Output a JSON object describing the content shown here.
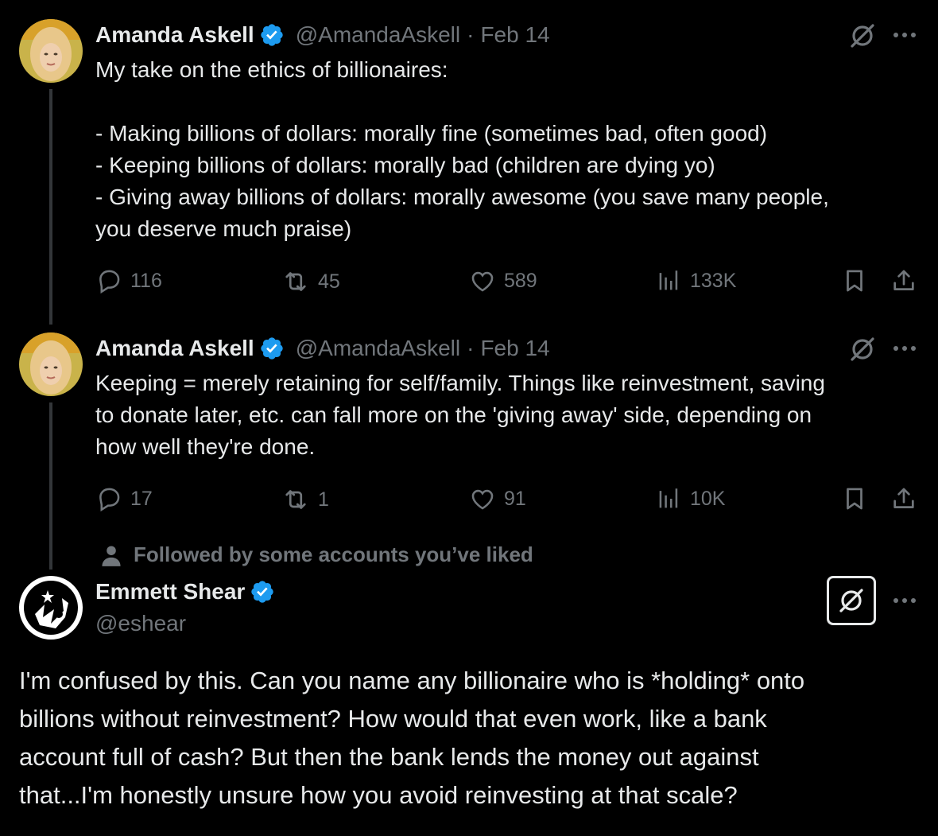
{
  "tweets": [
    {
      "name": "Amanda Askell",
      "handle": "@AmandaAskell",
      "separator": "·",
      "date": "Feb 14",
      "text": "My take on the ethics of billionaires:\n\n- Making billions of dollars: morally fine (sometimes bad, often good)\n- Keeping billions of dollars: morally bad (children are dying yo)\n- Giving away billions of dollars: morally awesome (you save many people,\nyou deserve much praise)",
      "replies": "116",
      "reposts": "45",
      "likes": "589",
      "views": "133K"
    },
    {
      "name": "Amanda Askell",
      "handle": "@AmandaAskell",
      "separator": "·",
      "date": "Feb 14",
      "text": "Keeping = merely retaining for self/family. Things like reinvestment, saving\nto donate later, etc. can fall more on the 'giving away' side, depending on\nhow well they're done.",
      "replies": "17",
      "reposts": "1",
      "likes": "91",
      "views": "10K"
    }
  ],
  "social_context": "Followed by some accounts you’ve liked",
  "main_tweet": {
    "name": "Emmett Shear",
    "handle": "@eshear",
    "text": "I'm confused by this. Can you name any billionaire who is *holding* onto\nbillions without reinvestment? How would that even work, like a bank\naccount full of cash? But then the bank lends the money out against\nthat...I'm honestly unsure how you avoid reinvesting at that scale?"
  },
  "colors": {
    "background": "#000000",
    "text": "#e7e9ea",
    "secondary": "#71767b",
    "verified": "#1d9bf0",
    "thread_line": "#333639"
  },
  "icons": [
    "verified-badge-icon",
    "grok-icon",
    "more-icon",
    "reply-icon",
    "repost-icon",
    "like-icon",
    "views-icon",
    "bookmark-icon",
    "share-icon",
    "person-icon"
  ]
}
